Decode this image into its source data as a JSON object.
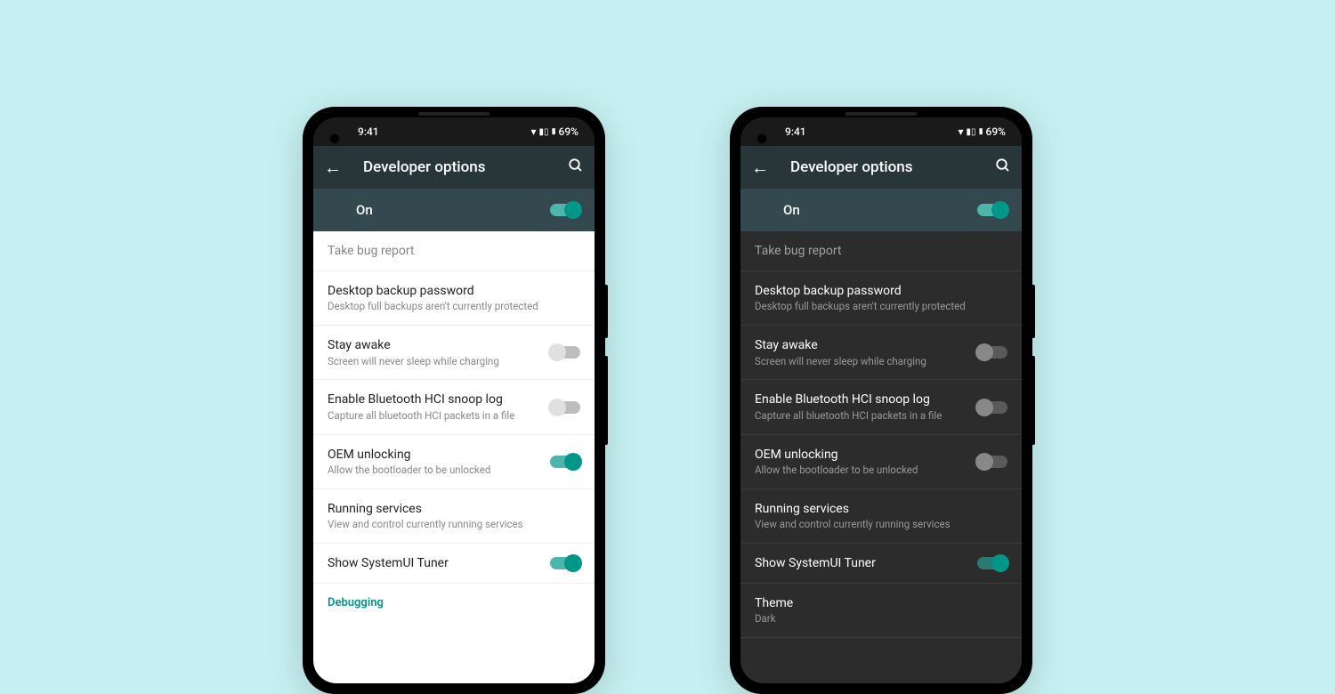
{
  "status": {
    "time": "9:41",
    "battery": "69%"
  },
  "appbar": {
    "title": "Developer options"
  },
  "master": {
    "label": "On"
  },
  "phones": {
    "light": {
      "rows": [
        {
          "title": "Take bug report",
          "muted": true
        },
        {
          "title": "Desktop backup password",
          "sub": "Desktop full backups aren't currently protected"
        },
        {
          "title": "Stay awake",
          "sub": "Screen will never sleep while charging",
          "toggle": "off"
        },
        {
          "title": "Enable Bluetooth HCI snoop log",
          "sub": "Capture all bluetooth HCI packets in a file",
          "toggle": "off"
        },
        {
          "title": "OEM unlocking",
          "sub": "Allow the bootloader to be unlocked",
          "toggle": "on"
        },
        {
          "title": "Running services",
          "sub": "View and control currently running services"
        },
        {
          "title": "Show SystemUI Tuner",
          "toggle": "on"
        }
      ],
      "section": "Debugging"
    },
    "dark": {
      "rows": [
        {
          "title": "Take bug report",
          "muted": true
        },
        {
          "title": "Desktop backup password",
          "sub": "Desktop full backups aren't currently protected"
        },
        {
          "title": "Stay awake",
          "sub": "Screen will never sleep while charging",
          "toggle": "off"
        },
        {
          "title": "Enable Bluetooth HCI snoop log",
          "sub": "Capture all bluetooth HCI packets in a file",
          "toggle": "off"
        },
        {
          "title": "OEM unlocking",
          "sub": "Allow the bootloader to be unlocked",
          "toggle": "off"
        },
        {
          "title": "Running services",
          "sub": "View and control currently running services"
        },
        {
          "title": "Show SystemUI Tuner",
          "toggle": "on"
        },
        {
          "title": "Theme",
          "sub": "Dark"
        }
      ]
    }
  }
}
